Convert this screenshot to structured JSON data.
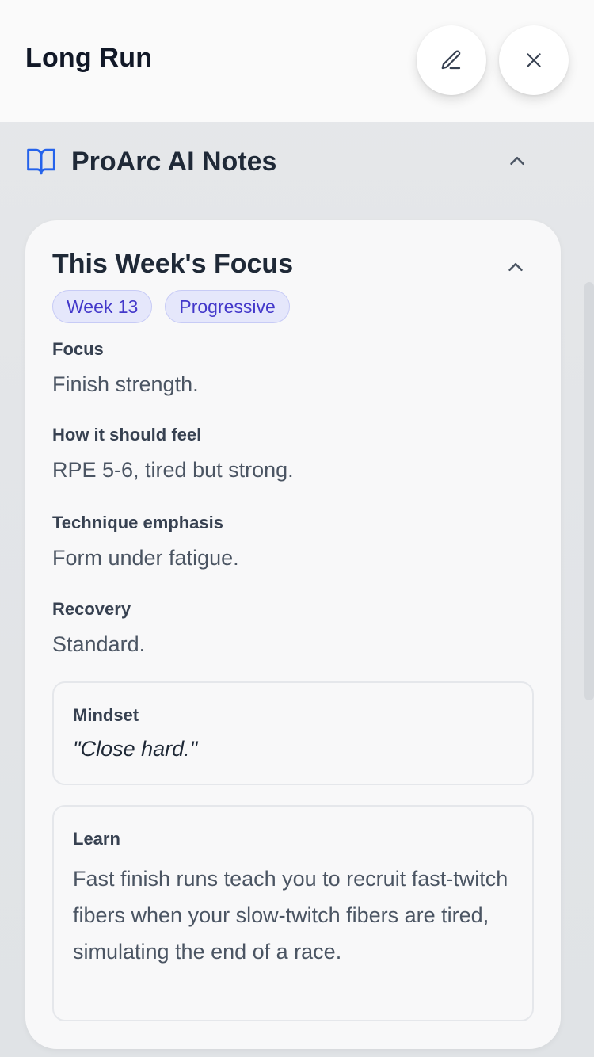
{
  "header": {
    "title": "Long Run",
    "edit_icon": "pencil-icon",
    "close_icon": "close-icon"
  },
  "section": {
    "title": "ProArc AI Notes",
    "icon": "book-open-icon",
    "toggle_icon": "chevron-up-icon"
  },
  "card": {
    "title": "This Week's Focus",
    "toggle_icon": "chevron-up-icon",
    "badges": [
      "Week 13",
      "Progressive"
    ],
    "fields": [
      {
        "label": "Focus",
        "value": "Finish strength."
      },
      {
        "label": "How it should feel",
        "value": "RPE 5-6, tired but strong."
      },
      {
        "label": "Technique emphasis",
        "value": "Form under fatigue."
      },
      {
        "label": "Recovery",
        "value": "Standard."
      }
    ],
    "mindset": {
      "label": "Mindset",
      "quote": "\"Close hard.\""
    },
    "learn": {
      "label": "Learn",
      "text": "Fast finish runs teach you to recruit fast-twitch fibers when your slow-twitch fibers are tired, simulating the end of a race."
    }
  },
  "colors": {
    "accent": "#2563eb",
    "badge_text": "#4338ca",
    "badge_bg": "#e5e7fb"
  }
}
